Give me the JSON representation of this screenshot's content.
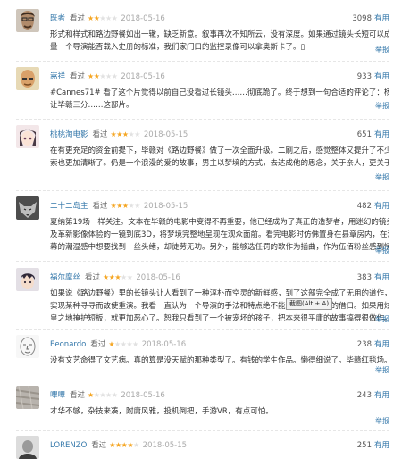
{
  "comments": [
    {
      "user": "既者",
      "action": "看过",
      "rating": 2,
      "date": "2018-05-16",
      "votes": "3098",
      "useful_label": "有用",
      "lines": [
        "形式和样式和路边野餐如出一辙，缺乏新意。叙事再次不知所云，没有深度。如果通过镜头长短可以成为衡",
        "量一个导演能否载入史册的标准，我们家门口的监控录像可以拿奥斯卡了。▯"
      ],
      "report": "举报",
      "avatar_icon": "man-glasses-portrait"
    },
    {
      "user": "嵩祥",
      "action": "看过",
      "rating": 2,
      "date": "2018-05-16",
      "votes": "933",
      "useful_label": "有用",
      "lines": [
        "#Cannes71# 看了这个片觉得以前自己没看过长镜头……彻底跪了。终于想到一句合适的评论了：杨紫都得",
        "让毕赣三分……这部片。"
      ],
      "report": "举报",
      "avatar_icon": "bald-man-portrait"
    },
    {
      "user": "桃桃淘电影",
      "action": "看过",
      "rating": 3,
      "date": "2018-05-15",
      "votes": "651",
      "useful_label": "有用",
      "lines": [
        "在有更充足的资金前提下，毕赣对《路边野餐》做了一次全面升级。二刷之后，感觉整体又提升了不少，线",
        "索也更加清晰了。仍是一个浪漫的爱的故事，男主以梦境的方式，去达成他的思念，关于亲人，更关于爱人。"
      ],
      "report": "举报",
      "avatar_icon": "anime-girl-portrait"
    },
    {
      "user": "二十二岛主",
      "action": "看过",
      "rating": 3,
      "date": "2018-05-15",
      "votes": "482",
      "useful_label": "有用",
      "lines": [
        "夏纳第19场一样关注。文本在毕赣的电影中变得不再重要，他已经成为了真正的造梦者，用迷幻的镜头以",
        "及革新影像体验的一镜到底3D，将梦境完整地呈现在观众面前。看完电影时仿佛置身在县章房内，在溢出屏",
        "幕的潮湿感中想要找到一丝头绪，却徒劳无功。另外，能够选任罚的歌作为插曲，作为伍佰粉丝感到惊喜！"
      ],
      "report": "举报",
      "avatar_icon": "wolf-head-portrait"
    },
    {
      "user": "福尔摩丝",
      "action": "看过",
      "rating": 3,
      "date": "2018-05-16",
      "votes": "383",
      "useful_label": "有用",
      "lines": [
        "如果说《路边野餐》里的长镜头让人看到了一种淳朴而空灵的新鲜感，到了这部完全成了无用的道作，为了",
        "实现某种寻寻而故使重演。我看一直认为一个导演的手法和特点绝不能成为掩盖叙事的借口。如果用炫技堂而",
        "皇之地掩护短板，就更加恶心了。恕我只看到了一个被宠坏的孩子，把本来很平庸的故事搞得很做作。"
      ],
      "report": "举报",
      "avatar_icon": "anime-boy-portrait"
    },
    {
      "user": "Eeonardo",
      "action": "看过",
      "rating": 1,
      "date": "2018-05-16",
      "votes": "238",
      "useful_label": "有用",
      "lines": [
        "没有文艺命得了文艺病。真的算是没天赋的那种类型了。有钱的学生作品。懒得细说了。毕赣红毯场。"
      ],
      "report": "举报",
      "avatar_icon": "sketch-face-portrait"
    },
    {
      "user": "嗶嗶",
      "action": "看过",
      "rating": 1,
      "date": "2018-05-16",
      "votes": "243",
      "useful_label": "有用",
      "lines": [
        "才华不够，杂技来凑，附庸风雅，投机倒把，手游VR，有点可怕。"
      ],
      "report": "举报",
      "avatar_icon": "grey-texture-portrait"
    },
    {
      "user": "LORENZO",
      "action": "看过",
      "rating": 4,
      "date": "2018-05-15",
      "votes": "251",
      "useful_label": "有用",
      "lines": [],
      "report": "",
      "avatar_icon": "bw-portrait"
    }
  ],
  "tooltip": "截图(Alt + A)",
  "colors": {
    "link": "#3377aa",
    "star": "#f5a623",
    "star_off": "#e1e1e1",
    "text": "#333333",
    "date": "#aaaaaa"
  }
}
